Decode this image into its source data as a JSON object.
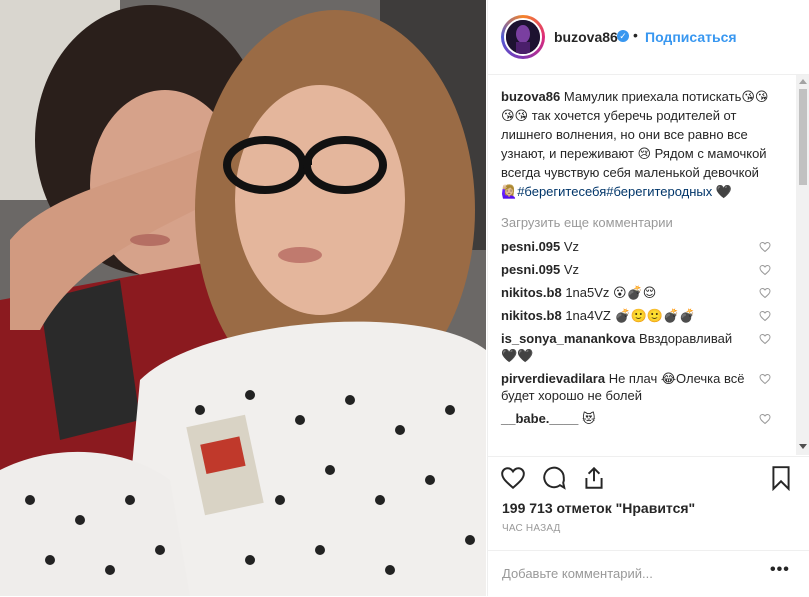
{
  "header": {
    "username": "buzova86",
    "verified_glyph": "✓",
    "separator": "•",
    "follow_label": "Подписаться"
  },
  "caption": {
    "username": "buzova86",
    "text": "Мамулик приехала потискать😘😘😘😘 так хочется уберечь родителей от лишнего волнения, но они все равно все узнают, и переживают 😢 Рядом с мамочкой всегда чувствую себя маленькой девочкой 🙋🏼‍♀️",
    "tags": "#берегитесебя#берегитеродных",
    "tail": "🖤"
  },
  "load_more": "Загрузить еще комментарии",
  "comments": [
    {
      "user": "pesni.095",
      "text": "Vz"
    },
    {
      "user": "pesni.095",
      "text": "Vz"
    },
    {
      "user": "nikitos.b8",
      "text": "1na5Vz 😮💣😌"
    },
    {
      "user": "nikitos.b8",
      "text": "1na4VZ 💣🙂🙂💣💣"
    },
    {
      "user": "is_sonya_manankova",
      "text": "Ввздоравливай 🖤🖤"
    },
    {
      "user": "pirverdievadilara",
      "text": "Не плач 😂Олечка всё будет хорошо не болей"
    },
    {
      "user": "__babe.____",
      "text": "😻"
    }
  ],
  "likes": "199 713 отметок \"Нравится\"",
  "time": "ЧАС НАЗАД",
  "add_comment": {
    "placeholder": "Добавьте комментарий...",
    "more": "•••"
  },
  "icons": [
    "heart-icon",
    "comment-icon",
    "share-icon",
    "bookmark-icon",
    "like-comment-heart-icon",
    "verified-badge-icon"
  ],
  "colors": {
    "link": "#3897f0",
    "hashtag": "#003569",
    "muted": "#999999",
    "text": "#262626"
  }
}
